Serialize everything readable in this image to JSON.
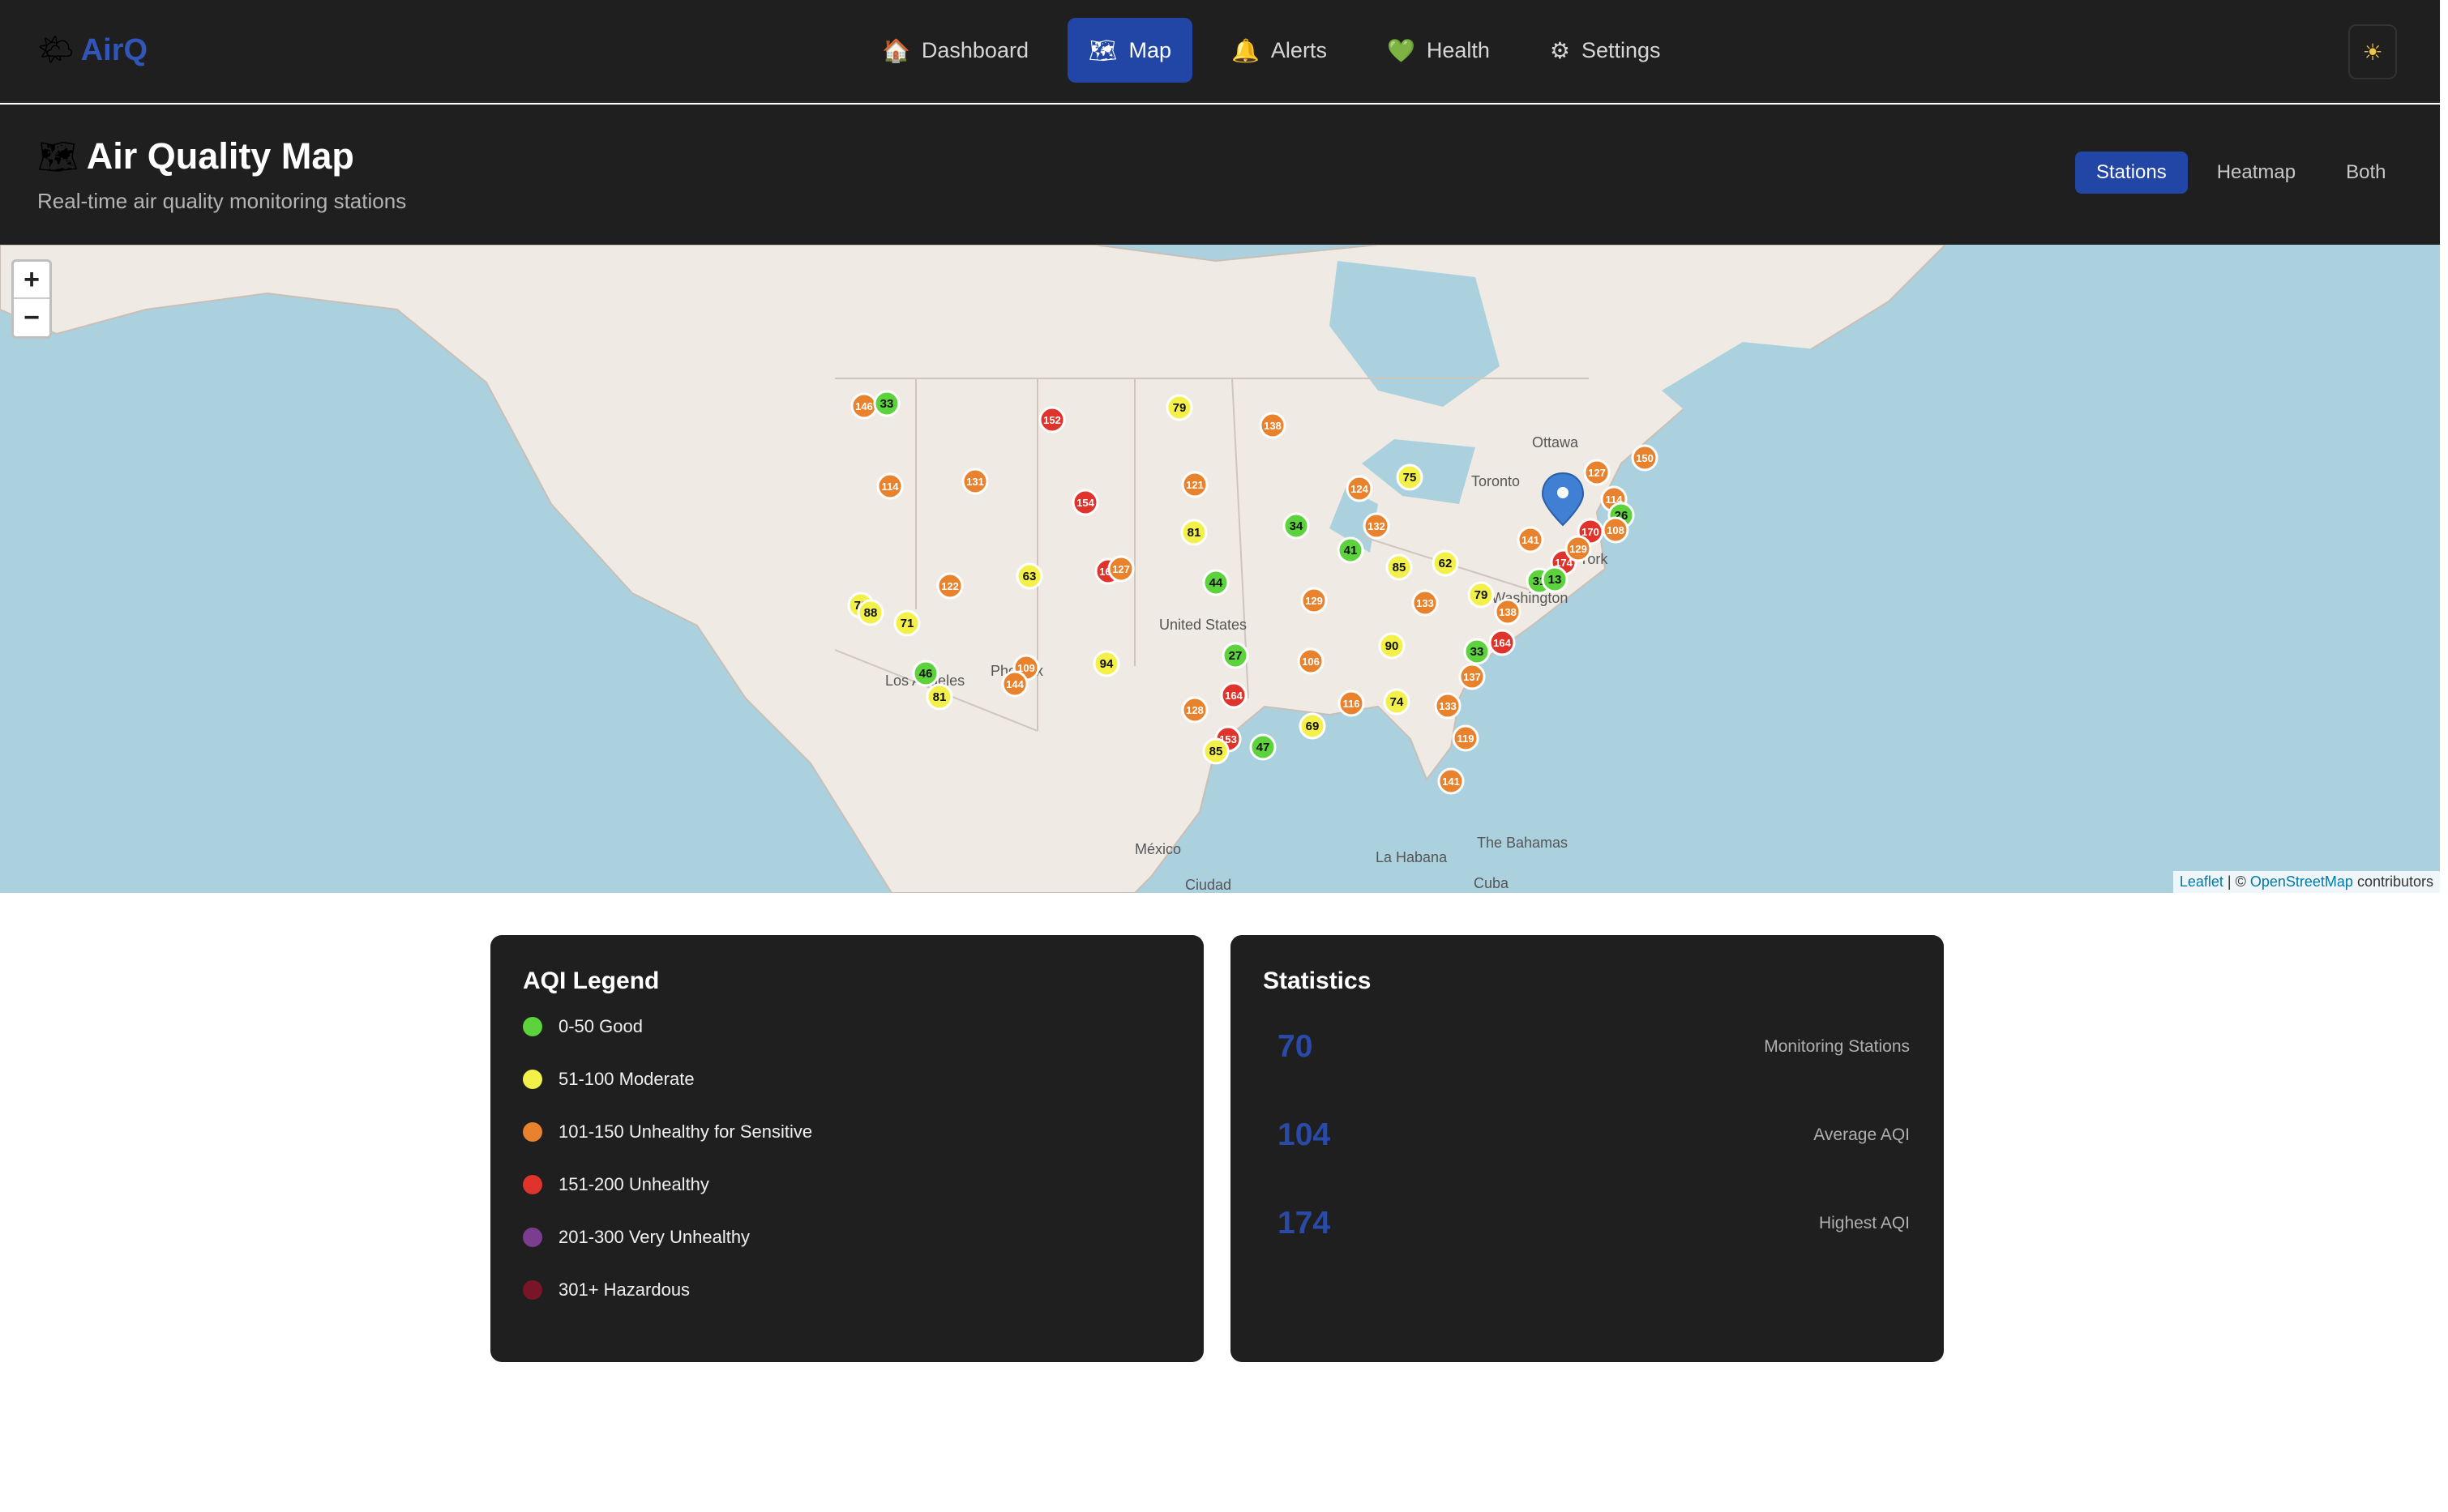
{
  "app": {
    "logo_icon": "🌤",
    "name": "AirQ",
    "theme_icon": "☀"
  },
  "nav": [
    {
      "icon": "🏠",
      "label": "Dashboard",
      "active": false
    },
    {
      "icon": "🗺",
      "label": "Map",
      "active": true
    },
    {
      "icon": "🔔",
      "label": "Alerts",
      "active": false
    },
    {
      "icon": "💚",
      "label": "Health",
      "active": false
    },
    {
      "icon": "⚙",
      "label": "Settings",
      "active": false
    }
  ],
  "page": {
    "icon": "🗺",
    "title": "Air Quality Map",
    "subtitle": "Real-time air quality monitoring stations"
  },
  "view_modes": [
    {
      "label": "Stations",
      "active": true
    },
    {
      "label": "Heatmap",
      "active": false
    },
    {
      "label": "Both",
      "active": false
    }
  ],
  "map": {
    "zoom_in": "+",
    "zoom_out": "−",
    "attribution": {
      "leaflet": "Leaflet",
      "sep": "| ©",
      "osm": "OpenStreetMap",
      "suffix": "contributors"
    },
    "place_labels": [
      "Ottawa",
      "Toronto",
      "Washington",
      "York",
      "United States",
      "Los Angeles",
      "Phoenix",
      "México",
      "Ciudad",
      "La Habana",
      "The Bahamas",
      "Cuba"
    ],
    "stations": [
      {
        "aqi": "146",
        "level": "usg"
      },
      {
        "aqi": "33",
        "level": "good"
      },
      {
        "aqi": "152",
        "level": "unhealthy"
      },
      {
        "aqi": "79",
        "level": "moderate"
      },
      {
        "aqi": "138",
        "level": "usg"
      },
      {
        "aqi": "114",
        "level": "usg"
      },
      {
        "aqi": "131",
        "level": "usg"
      },
      {
        "aqi": "154",
        "level": "unhealthy"
      },
      {
        "aqi": "121",
        "level": "usg"
      },
      {
        "aqi": "75",
        "level": "moderate"
      },
      {
        "aqi": "124",
        "level": "usg"
      },
      {
        "aqi": "34",
        "level": "good"
      },
      {
        "aqi": "132",
        "level": "usg"
      },
      {
        "aqi": "81",
        "level": "moderate"
      },
      {
        "aqi": "41",
        "level": "good"
      },
      {
        "aqi": "85",
        "level": "moderate"
      },
      {
        "aqi": "62",
        "level": "moderate"
      },
      {
        "aqi": "127",
        "level": "usg"
      },
      {
        "aqi": "150",
        "level": "usg"
      },
      {
        "aqi": "114",
        "level": "usg"
      },
      {
        "aqi": "26",
        "level": "good"
      },
      {
        "aqi": "170",
        "level": "unhealthy"
      },
      {
        "aqi": "108",
        "level": "usg"
      },
      {
        "aqi": "141",
        "level": "usg"
      },
      {
        "aqi": "174",
        "level": "unhealthy"
      },
      {
        "aqi": "129",
        "level": "usg"
      },
      {
        "aqi": "31",
        "level": "good"
      },
      {
        "aqi": "13",
        "level": "good"
      },
      {
        "aqi": "122",
        "level": "usg"
      },
      {
        "aqi": "63",
        "level": "moderate"
      },
      {
        "aqi": "162",
        "level": "unhealthy"
      },
      {
        "aqi": "127",
        "level": "usg"
      },
      {
        "aqi": "44",
        "level": "good"
      },
      {
        "aqi": "129",
        "level": "usg"
      },
      {
        "aqi": "133",
        "level": "usg"
      },
      {
        "aqi": "79",
        "level": "moderate"
      },
      {
        "aqi": "138",
        "level": "usg"
      },
      {
        "aqi": "72",
        "level": "moderate"
      },
      {
        "aqi": "88",
        "level": "moderate"
      },
      {
        "aqi": "71",
        "level": "moderate"
      },
      {
        "aqi": "27",
        "level": "good"
      },
      {
        "aqi": "106",
        "level": "usg"
      },
      {
        "aqi": "90",
        "level": "moderate"
      },
      {
        "aqi": "33",
        "level": "good"
      },
      {
        "aqi": "164",
        "level": "unhealthy"
      },
      {
        "aqi": "46",
        "level": "good"
      },
      {
        "aqi": "109",
        "level": "usg"
      },
      {
        "aqi": "144",
        "level": "usg"
      },
      {
        "aqi": "94",
        "level": "moderate"
      },
      {
        "aqi": "164",
        "level": "unhealthy"
      },
      {
        "aqi": "137",
        "level": "usg"
      },
      {
        "aqi": "81",
        "level": "moderate"
      },
      {
        "aqi": "128",
        "level": "usg"
      },
      {
        "aqi": "116",
        "level": "usg"
      },
      {
        "aqi": "74",
        "level": "moderate"
      },
      {
        "aqi": "133",
        "level": "usg"
      },
      {
        "aqi": "153",
        "level": "unhealthy"
      },
      {
        "aqi": "85",
        "level": "moderate"
      },
      {
        "aqi": "47",
        "level": "good"
      },
      {
        "aqi": "69",
        "level": "moderate"
      },
      {
        "aqi": "119",
        "level": "usg"
      },
      {
        "aqi": "141",
        "level": "usg"
      }
    ]
  },
  "legend": {
    "title": "AQI Legend",
    "items": [
      {
        "label": "0-50 Good",
        "color": "#5cd23c"
      },
      {
        "label": "51-100 Moderate",
        "color": "#f3f04a"
      },
      {
        "label": "101-150 Unhealthy for Sensitive",
        "color": "#e8822d"
      },
      {
        "label": "151-200 Unhealthy",
        "color": "#e0332b"
      },
      {
        "label": "201-300 Very Unhealthy",
        "color": "#7a3d8f"
      },
      {
        "label": "301+ Hazardous",
        "color": "#7a1528"
      }
    ]
  },
  "stats": {
    "title": "Statistics",
    "rows": [
      {
        "value": "70",
        "label": "Monitoring Stations"
      },
      {
        "value": "104",
        "label": "Average AQI"
      },
      {
        "value": "174",
        "label": "Highest AQI"
      }
    ]
  },
  "colors": {
    "good": "#5cd23c",
    "moderate": "#f3f04a",
    "usg": "#e8822d",
    "unhealthy": "#e0332b",
    "accent": "#2146a5",
    "marker_pin": "#3f7fd4"
  }
}
